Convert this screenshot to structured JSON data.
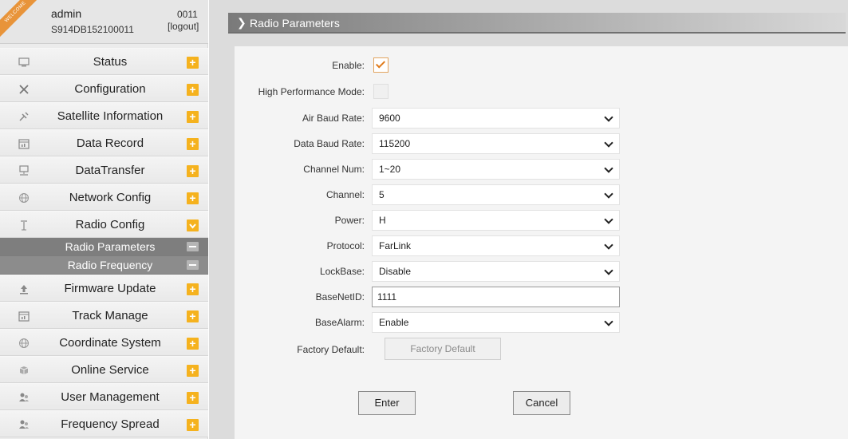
{
  "user": {
    "welcome": "WELCOME",
    "name": "admin",
    "serial": "S914DB152100011",
    "id": "0011",
    "logout": "[logout]"
  },
  "sidebar": {
    "items": [
      {
        "label": "Status",
        "icon": "monitor-icon"
      },
      {
        "label": "Configuration",
        "icon": "tools-icon"
      },
      {
        "label": "Satellite Information",
        "icon": "satellite-icon"
      },
      {
        "label": "Data Record",
        "icon": "calendar-icon"
      },
      {
        "label": "DataTransfer",
        "icon": "computer-icon"
      },
      {
        "label": "Network Config",
        "icon": "globe-icon"
      },
      {
        "label": "Radio Config",
        "icon": "antenna-icon"
      }
    ],
    "subitems": [
      {
        "label": "Radio Parameters"
      },
      {
        "label": "Radio Frequency"
      }
    ],
    "items2": [
      {
        "label": "Firmware Update",
        "icon": "upload-icon"
      },
      {
        "label": "Track Manage",
        "icon": "calendar-icon"
      },
      {
        "label": "Coordinate System",
        "icon": "globe-icon"
      },
      {
        "label": "Online Service",
        "icon": "box-icon"
      },
      {
        "label": "User Management",
        "icon": "users-icon"
      },
      {
        "label": "Frequency Spread",
        "icon": "users-icon"
      }
    ],
    "expand_symbol": "+",
    "collapse_symbol": "-"
  },
  "page": {
    "title": "Radio Parameters"
  },
  "form": {
    "enable_label": "Enable:",
    "enable_checked": true,
    "high_perf_label": "High Performance Mode:",
    "high_perf_checked": false,
    "air_baud_label": "Air Baud Rate:",
    "air_baud_value": "9600",
    "data_baud_label": "Data Baud Rate:",
    "data_baud_value": "115200",
    "channel_num_label": "Channel Num:",
    "channel_num_value": "1~20",
    "channel_label": "Channel:",
    "channel_value": "5",
    "power_label": "Power:",
    "power_value": "H",
    "protocol_label": "Protocol:",
    "protocol_value": "FarLink",
    "lockbase_label": "LockBase:",
    "lockbase_value": "Disable",
    "basenetid_label": "BaseNetID:",
    "basenetid_value": "1111",
    "basealarm_label": "BaseAlarm:",
    "basealarm_value": "Enable",
    "factory_label": "Factory Default:",
    "factory_button": "Factory Default",
    "enter_button": "Enter",
    "cancel_button": "Cancel"
  },
  "colors": {
    "accent": "#f5b21e",
    "check": "#e07b1a",
    "submenu": "#8c8c8c"
  }
}
